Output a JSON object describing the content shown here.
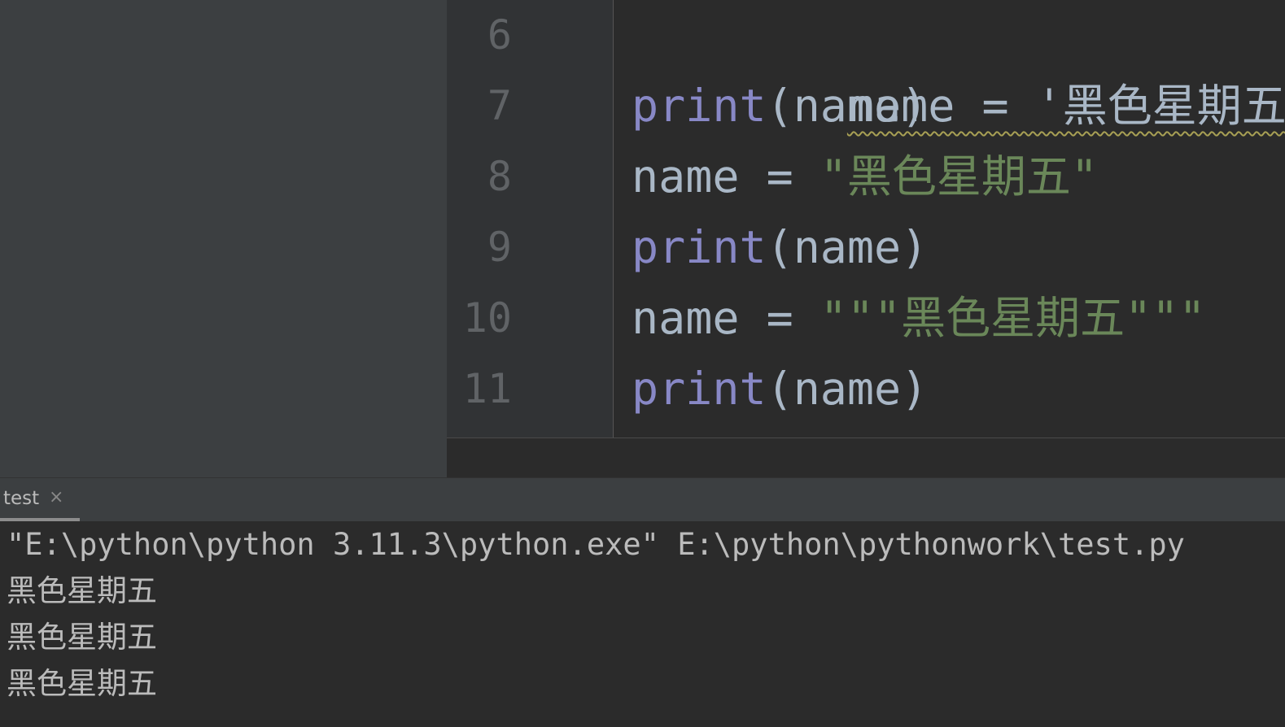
{
  "editor": {
    "lines": [
      {
        "num": "6",
        "parts": [
          {
            "t": "name = '黑色星期五'",
            "c": "warn"
          }
        ]
      },
      {
        "num": "7",
        "parts": [
          {
            "t": "print",
            "c": "kw"
          },
          {
            "t": "(name)",
            "c": "plain"
          }
        ]
      },
      {
        "num": "8",
        "parts": [
          {
            "t": "name = ",
            "c": "plain"
          },
          {
            "t": "\"黑色星期五\"",
            "c": "str"
          }
        ]
      },
      {
        "num": "9",
        "parts": [
          {
            "t": "print",
            "c": "kw"
          },
          {
            "t": "(name)",
            "c": "plain"
          }
        ]
      },
      {
        "num": "10",
        "parts": [
          {
            "t": "name = ",
            "c": "plain"
          },
          {
            "t": "\"\"\"黑色星期五\"\"\"",
            "c": "str"
          }
        ]
      },
      {
        "num": "11",
        "parts": [
          {
            "t": "print",
            "c": "kw"
          },
          {
            "t": "(name)",
            "c": "plain"
          }
        ]
      }
    ]
  },
  "run": {
    "tab_label": "test",
    "close_glyph": "×",
    "console": [
      "\"E:\\python\\python 3.11.3\\python.exe\" E:\\python\\pythonwork\\test.py",
      "黑色星期五",
      "黑色星期五",
      "黑色星期五"
    ]
  },
  "colors": {
    "keyword": "#8888c6",
    "string": "#6a8759",
    "identifier": "#a9b7c6",
    "line_number": "#606366",
    "warning_underline": "#a8a054"
  }
}
